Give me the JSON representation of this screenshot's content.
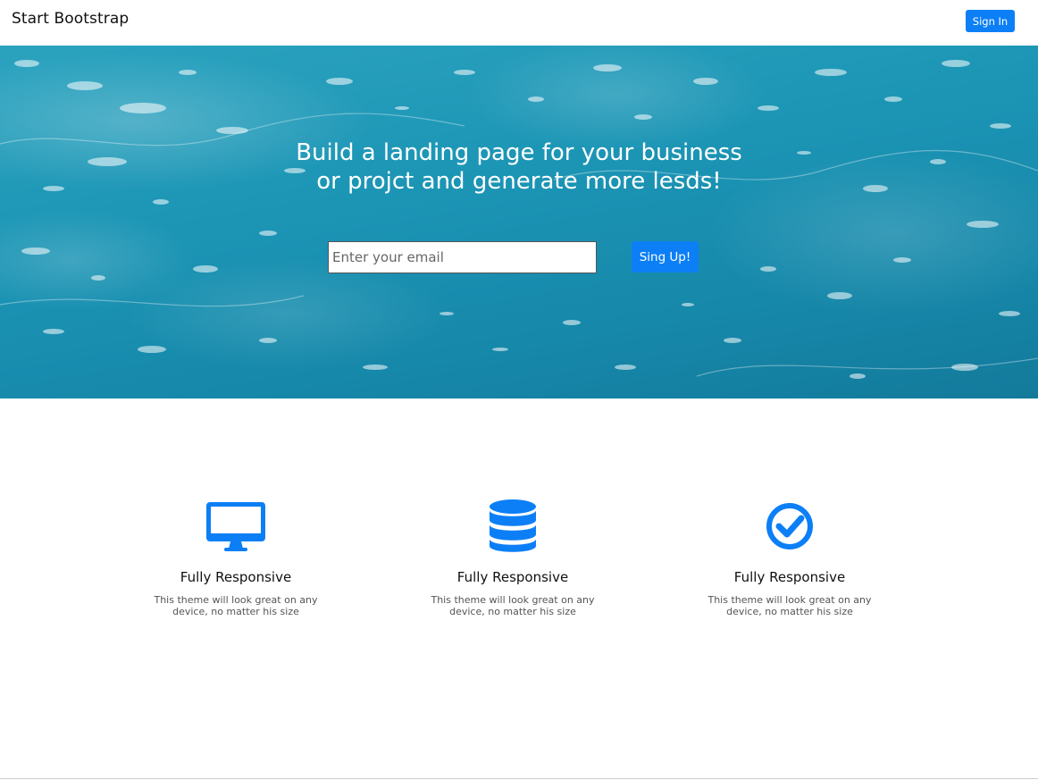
{
  "navbar": {
    "brand": "Start Bootstrap",
    "signin_label": "Sign In"
  },
  "hero": {
    "heading_line1": "Build a landing page for your business",
    "heading_line2": "or projct and generate more lesds!",
    "email_placeholder": "Enter your email",
    "signup_label": "Sing Up!"
  },
  "features": [
    {
      "icon": "desktop-icon",
      "title": "Fully Responsive",
      "text": "This theme will look great on any device, no matter his size"
    },
    {
      "icon": "database-icon",
      "title": "Fully Responsive",
      "text": "This theme will look great on any device, no matter his size"
    },
    {
      "icon": "check-circle-icon",
      "title": "Fully Responsive",
      "text": "This theme will look great on any device, no matter his size"
    }
  ],
  "colors": {
    "accent": "#0d7ff6",
    "hero_water": "#1c95b5"
  }
}
